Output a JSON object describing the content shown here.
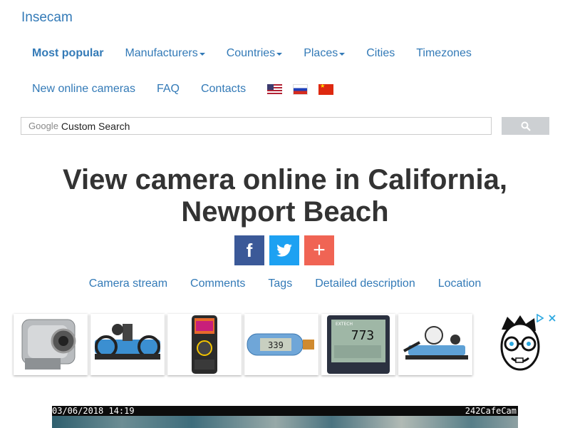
{
  "brand": "Insecam",
  "nav": {
    "row1": [
      {
        "label": "Most popular",
        "bold": true,
        "caret": false
      },
      {
        "label": "Manufacturers",
        "bold": false,
        "caret": true
      },
      {
        "label": "Countries",
        "bold": false,
        "caret": true
      },
      {
        "label": "Places",
        "bold": false,
        "caret": true
      },
      {
        "label": "Cities",
        "bold": false,
        "caret": false
      },
      {
        "label": "Timezones",
        "bold": false,
        "caret": false
      }
    ],
    "row2": [
      {
        "label": "New online cameras"
      },
      {
        "label": "FAQ"
      },
      {
        "label": "Contacts"
      }
    ],
    "flags": [
      "us-flag-icon",
      "russia-flag-icon",
      "china-flag-icon"
    ]
  },
  "search": {
    "brand": "Google",
    "placeholder": "Custom Search",
    "button_icon": "search-icon"
  },
  "page": {
    "title_line1": "View camera online in California,",
    "title_line2": "Newport Beach"
  },
  "share": {
    "facebook": "f",
    "twitter": "twitter-bird-icon",
    "plus": "+"
  },
  "anchors": [
    "Camera stream",
    "Comments",
    "Tags",
    "Detailed description",
    "Location"
  ],
  "ads": {
    "products": [
      "pipe-inspection-camera",
      "pressure-calibration-pump",
      "thermal-imaging-multimeter",
      "usb-data-logger",
      "indoor-air-quality-monitor",
      "hydraulic-pressure-tester"
    ],
    "datalogger_reading": "339",
    "monitor_reading": "773",
    "monitor_brand": "EXTECH",
    "choices_icon": "adchoices-icon",
    "close_icon": "close-icon"
  },
  "camera": {
    "timestamp": "03/06/2018 14:19",
    "name": "242CafeCam"
  },
  "colors": {
    "link": "#337ab7",
    "facebook": "#3b5998",
    "twitter": "#1da1f2",
    "plus": "#f06454"
  }
}
